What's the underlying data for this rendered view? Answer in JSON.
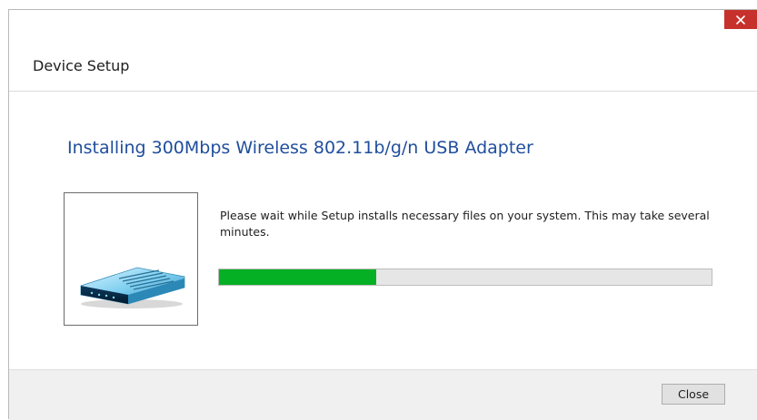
{
  "window": {
    "title": "Device Setup",
    "close_icon": "close-icon"
  },
  "main": {
    "heading": "Installing 300Mbps Wireless 802.11b/g/n USB Adapter",
    "message": "Please wait while Setup installs necessary files on your system. This may take several minutes.",
    "device_image": "usb-adapter-icon",
    "progress_fraction": 0.32
  },
  "footer": {
    "close_label": "Close"
  },
  "colors": {
    "heading": "#1f4e9c",
    "progress_fill": "#06b025",
    "close_x_bg": "#c7312b"
  }
}
